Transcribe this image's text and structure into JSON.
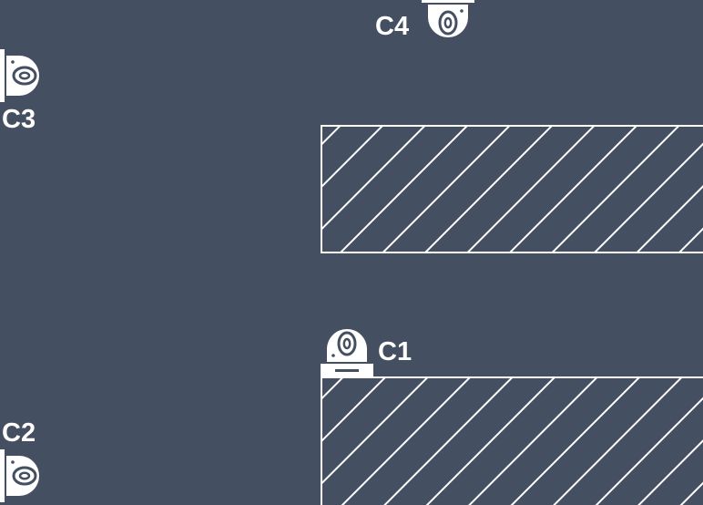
{
  "floorplan": {
    "background_color": "#454f62",
    "line_color": "#ffffff"
  },
  "cameras": [
    {
      "id": "c1",
      "label": "C1",
      "icon": "security-camera-icon",
      "mount": "floor-facing-up"
    },
    {
      "id": "c2",
      "label": "C2",
      "icon": "security-camera-icon",
      "mount": "left-wall-facing-right"
    },
    {
      "id": "c3",
      "label": "C3",
      "icon": "security-camera-icon",
      "mount": "left-wall-facing-right"
    },
    {
      "id": "c4",
      "label": "C4",
      "icon": "security-camera-icon",
      "mount": "ceiling-facing-down"
    }
  ],
  "obstacles": [
    {
      "id": "obstacle-upper",
      "fill": "hatched"
    },
    {
      "id": "obstacle-lower",
      "fill": "hatched"
    }
  ]
}
